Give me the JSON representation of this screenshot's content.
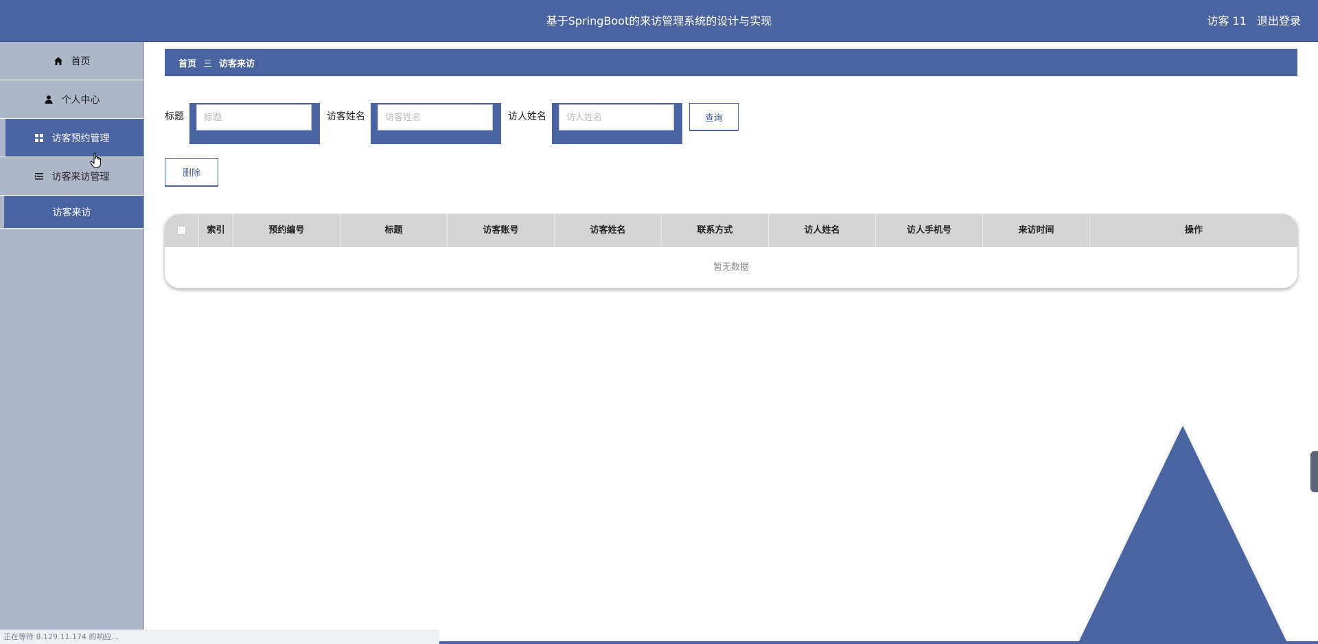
{
  "header": {
    "title": "基于SpringBoot的来访管理系统的设计与实现",
    "user_label": "访客 11",
    "logout_label": "退出登录"
  },
  "sidebar": {
    "items": [
      {
        "label": "首页",
        "icon": "home-icon"
      },
      {
        "label": "个人中心",
        "icon": "user-icon"
      },
      {
        "label": "访客预约管理",
        "icon": "grid-icon"
      },
      {
        "label": "访客来访管理",
        "icon": "list-icon"
      }
    ],
    "submenu": {
      "label": "访客来访"
    }
  },
  "breadcrumb": {
    "home": "首页",
    "separator": "三",
    "current": "访客来访"
  },
  "search": {
    "title_label": "标题",
    "title_placeholder": "标题",
    "visitor_label": "访客姓名",
    "visitor_placeholder": "访客姓名",
    "host_label": "访人姓名",
    "host_placeholder": "访人姓名",
    "query_button": "查询"
  },
  "actions": {
    "delete_button": "删除"
  },
  "table": {
    "columns": [
      "索引",
      "预约编号",
      "标题",
      "访客账号",
      "访客姓名",
      "联系方式",
      "访人姓名",
      "访人手机号",
      "来访时间",
      "操作"
    ],
    "empty_text": "暂无数据"
  },
  "status_bar": {
    "text": "正在等待 8.129.11.174 的响应..."
  },
  "colors": {
    "primary": "#4a64a1",
    "sidebar": "#aeb7c9",
    "table_header": "#d4d4d4"
  }
}
